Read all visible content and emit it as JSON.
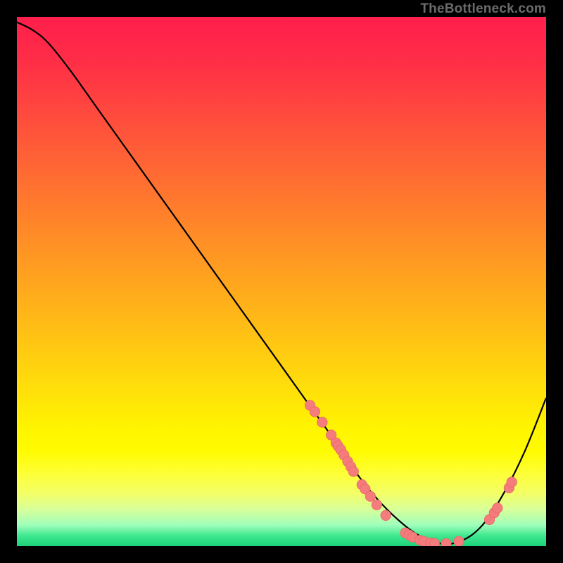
{
  "watermark": "TheBottleneck.com",
  "chart_data": {
    "type": "line",
    "title": "",
    "xlabel": "",
    "ylabel": "",
    "xlim": [
      0,
      100
    ],
    "ylim": [
      0,
      100
    ],
    "series": [
      {
        "name": "curve",
        "x": [
          0,
          3,
          6,
          10,
          15,
          20,
          25,
          30,
          35,
          40,
          45,
          50,
          55,
          60,
          64,
          68,
          72,
          76,
          80,
          84,
          88,
          92,
          96,
          100
        ],
        "y": [
          99,
          97.5,
          95,
          90,
          83,
          76,
          69,
          62,
          55,
          48,
          41,
          34,
          27,
          20,
          14,
          9,
          5,
          2,
          0.5,
          1,
          4,
          10,
          18,
          28
        ]
      }
    ],
    "scatter": [
      {
        "x": 55.4,
        "y": 26.6
      },
      {
        "x": 56.3,
        "y": 25.4
      },
      {
        "x": 57.7,
        "y": 23.4
      },
      {
        "x": 59.4,
        "y": 21.0
      },
      {
        "x": 60.3,
        "y": 19.5
      },
      {
        "x": 60.7,
        "y": 18.9
      },
      {
        "x": 61.2,
        "y": 18.2
      },
      {
        "x": 61.8,
        "y": 17.2
      },
      {
        "x": 62.5,
        "y": 16.0
      },
      {
        "x": 63.1,
        "y": 15.0
      },
      {
        "x": 63.6,
        "y": 14.1
      },
      {
        "x": 65.2,
        "y": 11.6
      },
      {
        "x": 65.8,
        "y": 10.8
      },
      {
        "x": 66.8,
        "y": 9.4
      },
      {
        "x": 68.0,
        "y": 7.8
      },
      {
        "x": 69.7,
        "y": 5.8
      },
      {
        "x": 73.4,
        "y": 2.5
      },
      {
        "x": 74.1,
        "y": 2.1
      },
      {
        "x": 74.8,
        "y": 1.7
      },
      {
        "x": 76.2,
        "y": 1.1
      },
      {
        "x": 76.9,
        "y": 0.9
      },
      {
        "x": 78.2,
        "y": 0.6
      },
      {
        "x": 78.9,
        "y": 0.5
      },
      {
        "x": 81.1,
        "y": 0.5
      },
      {
        "x": 83.5,
        "y": 0.9
      },
      {
        "x": 89.3,
        "y": 5.0
      },
      {
        "x": 90.2,
        "y": 6.3
      },
      {
        "x": 90.8,
        "y": 7.2
      },
      {
        "x": 93.0,
        "y": 11.0
      },
      {
        "x": 93.5,
        "y": 12.1
      }
    ],
    "colors": {
      "curve": "#000000",
      "points": "#f47c7c",
      "points_stroke": "#e96767"
    }
  }
}
